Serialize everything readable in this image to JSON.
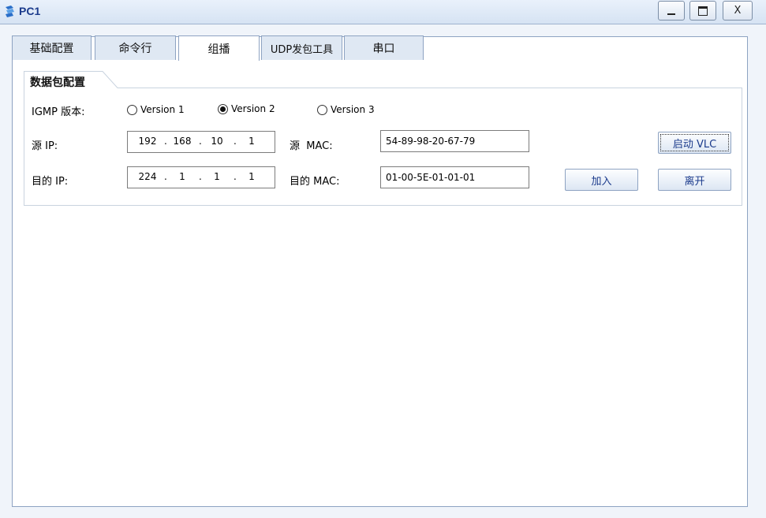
{
  "window": {
    "title": "PC1",
    "controls": {
      "minimize": "",
      "maximize": "",
      "close": "X"
    }
  },
  "tabs": [
    {
      "label": "基础配置",
      "active": false
    },
    {
      "label": "命令行",
      "active": false
    },
    {
      "label": "组播",
      "active": true
    },
    {
      "label": "UDP发包工具",
      "active": false
    },
    {
      "label": "串口",
      "active": false
    }
  ],
  "packet_config": {
    "title": "数据包配置",
    "igmp_label": "IGMP 版本:",
    "igmp_options": [
      {
        "label": "Version 1",
        "selected": false
      },
      {
        "label": "Version 2",
        "selected": true
      },
      {
        "label": "Version 3",
        "selected": false
      }
    ],
    "src_ip_label": "源 IP:",
    "src_ip": [
      "192",
      "168",
      "10",
      "1"
    ],
    "src_mac_label": "源  MAC:",
    "src_mac": "54-89-98-20-67-79",
    "dst_ip_label": "目的 IP:",
    "dst_ip": [
      "224",
      "1",
      "1",
      "1"
    ],
    "dst_mac_label": "目的 MAC:",
    "dst_mac": "01-00-5E-01-01-01",
    "buttons": {
      "start_vlc": "启动 VLC",
      "join": "加入",
      "leave": "离开"
    }
  },
  "colors": {
    "accent": "#1b3b8c",
    "window_bg": "#cfdcee"
  }
}
